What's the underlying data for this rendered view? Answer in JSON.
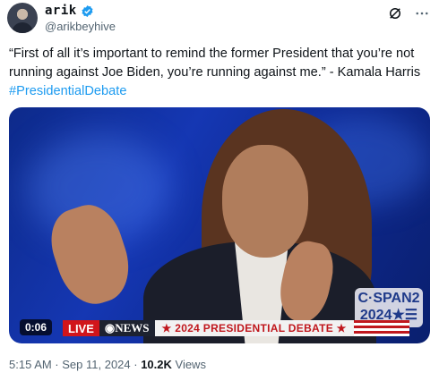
{
  "author": {
    "display_name": "arik",
    "handle": "@arikbeyhive",
    "verified": true
  },
  "tweet": {
    "text": "“First of all it’s important to remind the former President that you’re not running against Joe Biden, you’re running against me.” - Kamala Harris",
    "hashtag": "#PresidentialDebate"
  },
  "video": {
    "duration": "0:06",
    "live_label": "LIVE",
    "network_label": "NEWS",
    "debate_banner": "★ 2024 PRESIDENTIAL DEBATE ★",
    "cspan_line1": "C·SPAN2",
    "cspan_line2": "2024★☰"
  },
  "meta": {
    "timestamp": "5:15 AM · Sep 11, 2024 · ",
    "views_count": "10.2K",
    "views_label": " Views"
  },
  "icons": {
    "verified": "verified-badge-icon",
    "grok": "grok-icon",
    "more": "more-icon"
  },
  "colors": {
    "link": "#1d9bf0",
    "secondary_text": "#536471",
    "verified": "#1d9bf0"
  }
}
